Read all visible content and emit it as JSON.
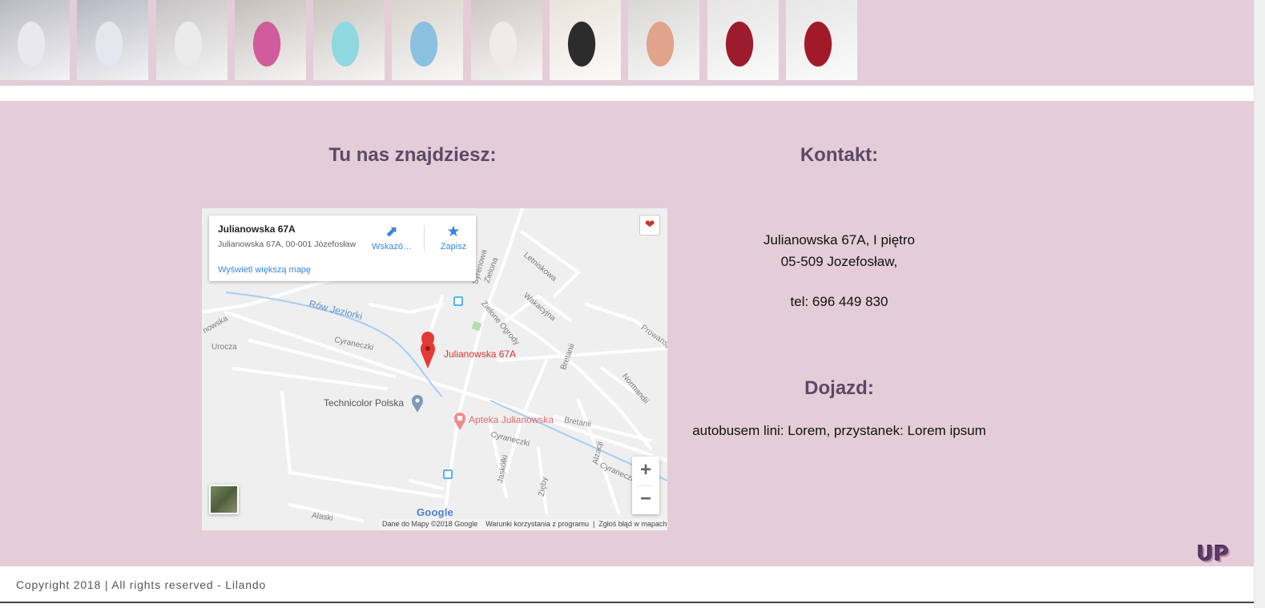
{
  "gallery": {
    "thumbs": [
      {
        "name": "nail-photo-1",
        "bg": "#b9b9c2",
        "accent": "#e8e8ee"
      },
      {
        "name": "nail-photo-2",
        "bg": "#b7b8c3",
        "accent": "#e5e6ee"
      },
      {
        "name": "nail-photo-3",
        "bg": "#c6c3c3",
        "accent": "#ecebeb"
      },
      {
        "name": "nail-photo-4",
        "bg": "#c4bfb8",
        "accent": "#d05c9b"
      },
      {
        "name": "nail-photo-5",
        "bg": "#c9c5bf",
        "accent": "#8fd8df"
      },
      {
        "name": "nail-photo-6",
        "bg": "#d7d3cc",
        "accent": "#8cc0e0"
      },
      {
        "name": "nail-photo-7",
        "bg": "#cfc7c4",
        "accent": "#f0ebe8"
      },
      {
        "name": "nail-photo-8",
        "bg": "#e9e3da",
        "accent": "#2c2c2c"
      },
      {
        "name": "nail-photo-9",
        "bg": "#d8d7d6",
        "accent": "#e0a48b"
      },
      {
        "name": "nail-photo-10",
        "bg": "#e6e4e4",
        "accent": "#9c1b2c"
      },
      {
        "name": "nail-photo-11",
        "bg": "#e7e6e7",
        "accent": "#a11a2a"
      }
    ]
  },
  "location": {
    "heading": "Tu nas znajdziesz:"
  },
  "map": {
    "card_title": "Julianowska 67A",
    "card_address": "Julianowska 67A, 00-001 Józefosław",
    "directions_label": "Wskazó…",
    "save_label": "Zapisz",
    "larger_map_link": "Wyświetl większą mapę",
    "pin_label": "Julianowska 67A",
    "poi_technicolor": "Technicolor Polska",
    "poi_pharmacy": "Apteka Julianowska",
    "streets": {
      "row_jeziorki": "Rów Jeziorki",
      "cyraneczki": "Cyraneczki",
      "cyraneczki_2": "Cyraneczki",
      "cyraneczki_3": "Cyraneczki",
      "urocza": "Urocza",
      "zielone_ogrody": "Zielone Ogrody",
      "letniskowa": "Letniskowa",
      "wakacyjna": "Wakacyjna",
      "bretanii": "Bretanii",
      "bretanii_2": "Bretanii",
      "normandii": "Normandii",
      "alzacji": "Alzacji",
      "jaskolki": "Jaskółki",
      "zieby": "Zięby",
      "alaski": "Alaski",
      "prowansji": "Prowansji",
      "julianowska": "nowska",
      "zielona": "Zielona",
      "syrenowa": "Syrenowa"
    },
    "google_logo": "Google",
    "footer_data": "Dane do Mapy ©2018 Google",
    "footer_terms": "Warunki korzystania z programu",
    "footer_report": "Zgłoś błąd w mapach",
    "zoom_in": "+",
    "zoom_out": "−"
  },
  "contact": {
    "heading": "Kontakt:",
    "address_line1": "Julianowska 67A, I piętro",
    "address_line2": "05-509 Jozefosław,",
    "phone": "tel: 696 449 830"
  },
  "transit": {
    "heading": "Dojazd:",
    "text": "autobusem lini: Lorem, przystanek: Lorem ipsum"
  },
  "up_button": "UP",
  "footer": {
    "copyright": "Copyright 2018 | All rights reserved - Lilando"
  },
  "colors": {
    "section_bg": "#e4cdd9",
    "heading": "#5b4a66",
    "map_link": "#3a84df",
    "pin": "#e53935"
  }
}
